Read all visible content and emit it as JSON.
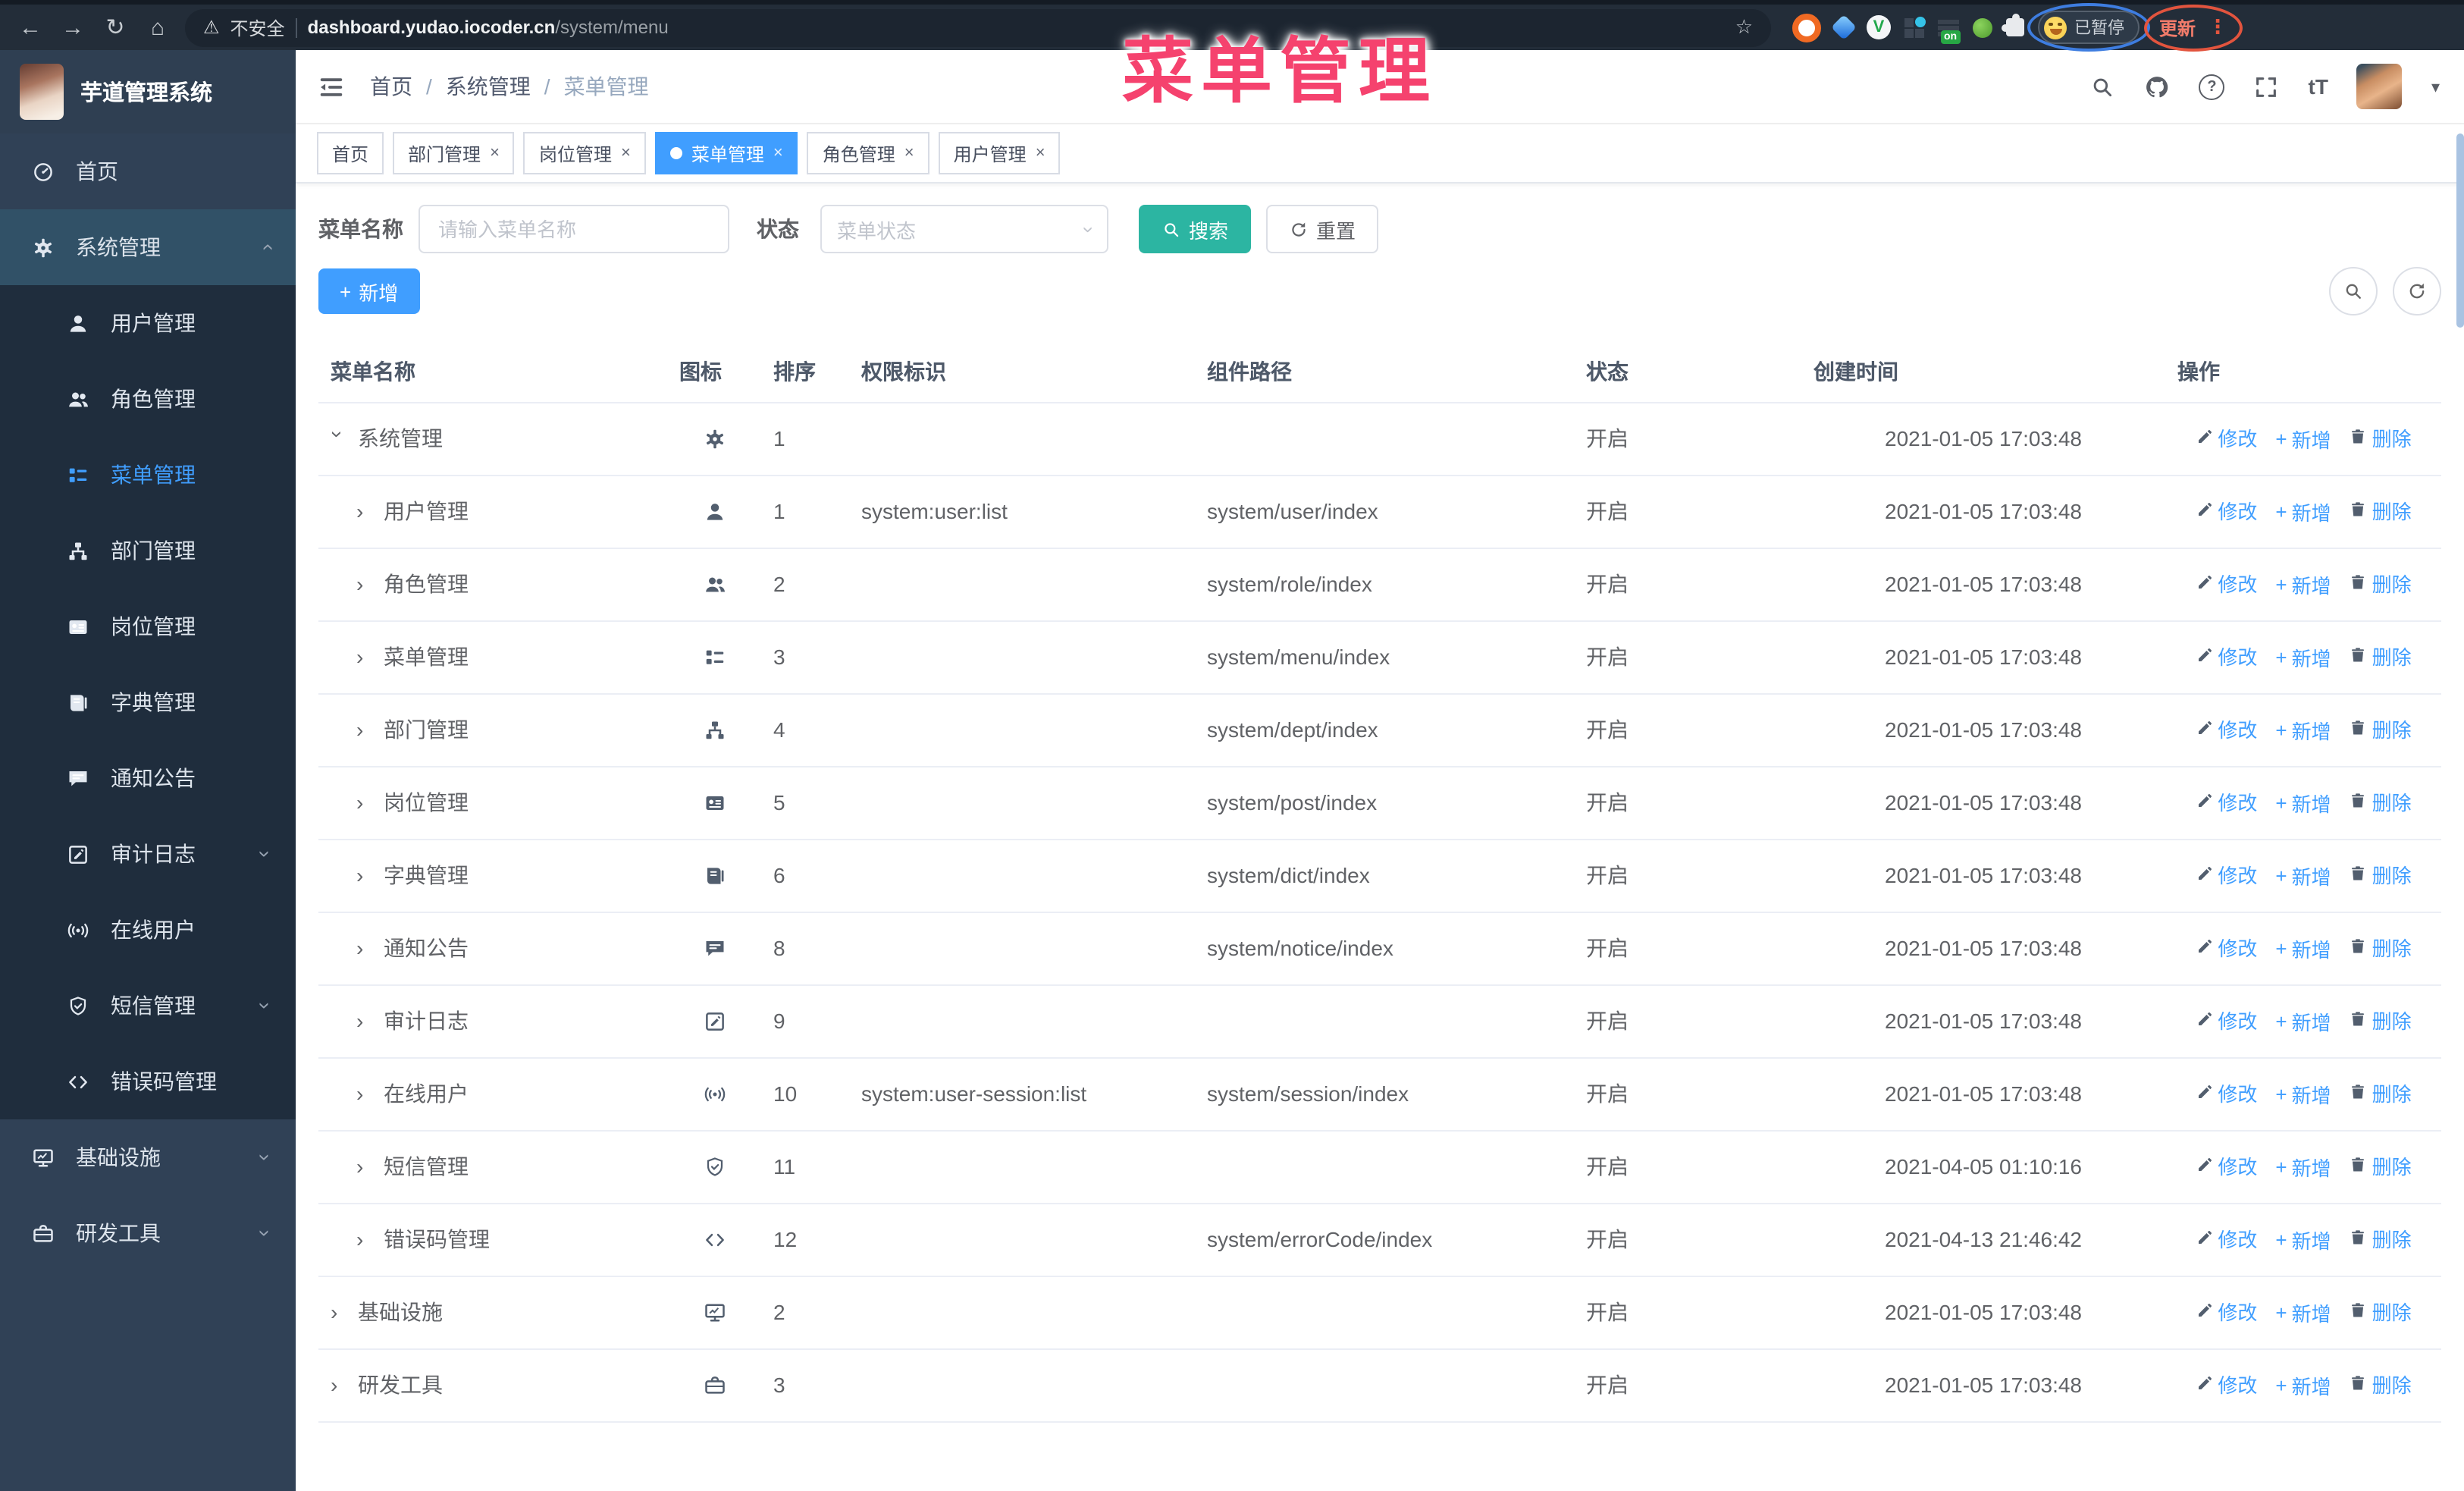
{
  "colors": {
    "primary": "#409eff",
    "search_button_teal": "#2cb5a2",
    "annotation_pink": "#f5426e",
    "sidebar_bg": "#304156",
    "sidebar_submenu_bg": "#1f2d3d"
  },
  "overlay": {
    "title": "菜单管理"
  },
  "browser": {
    "security_label": "不安全",
    "url_host": "dashboard.yudao.iocoder.cn",
    "url_path": "/system/menu",
    "ext_on_badge": "on",
    "paused_badge": "已暂停",
    "update_button": "更新"
  },
  "sidebar": {
    "app_title": "芋道管理系统",
    "items": [
      {
        "label": "首页",
        "icon": "dashboard",
        "level": 0
      },
      {
        "label": "系统管理",
        "icon": "gear",
        "level": 0,
        "selected": true,
        "chevron": "up"
      },
      {
        "label": "用户管理",
        "icon": "user",
        "level": 1
      },
      {
        "label": "角色管理",
        "icon": "users",
        "level": 1
      },
      {
        "label": "菜单管理",
        "icon": "menu",
        "level": 1,
        "active": true
      },
      {
        "label": "部门管理",
        "icon": "tree",
        "level": 1
      },
      {
        "label": "岗位管理",
        "icon": "idcard",
        "level": 1
      },
      {
        "label": "字典管理",
        "icon": "dict",
        "level": 1
      },
      {
        "label": "通知公告",
        "icon": "notice",
        "level": 1
      },
      {
        "label": "审计日志",
        "icon": "log",
        "level": 1,
        "chevron": "down"
      },
      {
        "label": "在线用户",
        "icon": "online",
        "level": 1
      },
      {
        "label": "短信管理",
        "icon": "shield",
        "level": 1,
        "chevron": "down"
      },
      {
        "label": "错误码管理",
        "icon": "code",
        "level": 1
      },
      {
        "label": "基础设施",
        "icon": "infra",
        "level": 0,
        "chevron": "down"
      },
      {
        "label": "研发工具",
        "icon": "tool",
        "level": 0,
        "chevron": "down"
      }
    ]
  },
  "header": {
    "breadcrumb": [
      "首页",
      "系统管理",
      "菜单管理"
    ],
    "separator": "/"
  },
  "tabs": [
    {
      "label": "首页",
      "closable": false,
      "active": false
    },
    {
      "label": "部门管理",
      "closable": true,
      "active": false
    },
    {
      "label": "岗位管理",
      "closable": true,
      "active": false
    },
    {
      "label": "菜单管理",
      "closable": true,
      "active": true
    },
    {
      "label": "角色管理",
      "closable": true,
      "active": false
    },
    {
      "label": "用户管理",
      "closable": true,
      "active": false
    }
  ],
  "filters": {
    "name_label": "菜单名称",
    "name_placeholder": "请输入菜单名称",
    "status_label": "状态",
    "status_placeholder": "菜单状态",
    "search_button": "搜索",
    "reset_button": "重置"
  },
  "toolbar": {
    "add_button": "新增"
  },
  "table": {
    "headers": [
      "菜单名称",
      "图标",
      "排序",
      "权限标识",
      "组件路径",
      "状态",
      "创建时间",
      "操作"
    ],
    "actions": {
      "edit": "修改",
      "add": "新增",
      "delete": "删除"
    },
    "rows": [
      {
        "name": "系统管理",
        "icon": "gear",
        "level": 0,
        "expanded": true,
        "order": "1",
        "perm": "",
        "path": "",
        "status": "开启",
        "time": "2021-01-05 17:03:48"
      },
      {
        "name": "用户管理",
        "icon": "user",
        "level": 1,
        "expanded": false,
        "order": "1",
        "perm": "system:user:list",
        "path": "system/user/index",
        "status": "开启",
        "time": "2021-01-05 17:03:48"
      },
      {
        "name": "角色管理",
        "icon": "users",
        "level": 1,
        "expanded": false,
        "order": "2",
        "perm": "",
        "path": "system/role/index",
        "status": "开启",
        "time": "2021-01-05 17:03:48"
      },
      {
        "name": "菜单管理",
        "icon": "menu",
        "level": 1,
        "expanded": false,
        "order": "3",
        "perm": "",
        "path": "system/menu/index",
        "status": "开启",
        "time": "2021-01-05 17:03:48"
      },
      {
        "name": "部门管理",
        "icon": "tree",
        "level": 1,
        "expanded": false,
        "order": "4",
        "perm": "",
        "path": "system/dept/index",
        "status": "开启",
        "time": "2021-01-05 17:03:48"
      },
      {
        "name": "岗位管理",
        "icon": "idcard",
        "level": 1,
        "expanded": false,
        "order": "5",
        "perm": "",
        "path": "system/post/index",
        "status": "开启",
        "time": "2021-01-05 17:03:48"
      },
      {
        "name": "字典管理",
        "icon": "dict",
        "level": 1,
        "expanded": false,
        "order": "6",
        "perm": "",
        "path": "system/dict/index",
        "status": "开启",
        "time": "2021-01-05 17:03:48"
      },
      {
        "name": "通知公告",
        "icon": "notice",
        "level": 1,
        "expanded": false,
        "order": "8",
        "perm": "",
        "path": "system/notice/index",
        "status": "开启",
        "time": "2021-01-05 17:03:48"
      },
      {
        "name": "审计日志",
        "icon": "log",
        "level": 1,
        "expanded": false,
        "order": "9",
        "perm": "",
        "path": "",
        "status": "开启",
        "time": "2021-01-05 17:03:48"
      },
      {
        "name": "在线用户",
        "icon": "online",
        "level": 1,
        "expanded": false,
        "order": "10",
        "perm": "system:user-session:list",
        "path": "system/session/index",
        "status": "开启",
        "time": "2021-01-05 17:03:48"
      },
      {
        "name": "短信管理",
        "icon": "shield",
        "level": 1,
        "expanded": false,
        "order": "11",
        "perm": "",
        "path": "",
        "status": "开启",
        "time": "2021-04-05 01:10:16"
      },
      {
        "name": "错误码管理",
        "icon": "code",
        "level": 1,
        "expanded": false,
        "order": "12",
        "perm": "",
        "path": "system/errorCode/index",
        "status": "开启",
        "time": "2021-04-13 21:46:42"
      },
      {
        "name": "基础设施",
        "icon": "infra",
        "level": 0,
        "expanded": false,
        "order": "2",
        "perm": "",
        "path": "",
        "status": "开启",
        "time": "2021-01-05 17:03:48"
      },
      {
        "name": "研发工具",
        "icon": "tool",
        "level": 0,
        "expanded": false,
        "order": "3",
        "perm": "",
        "path": "",
        "status": "开启",
        "time": "2021-01-05 17:03:48"
      }
    ]
  }
}
